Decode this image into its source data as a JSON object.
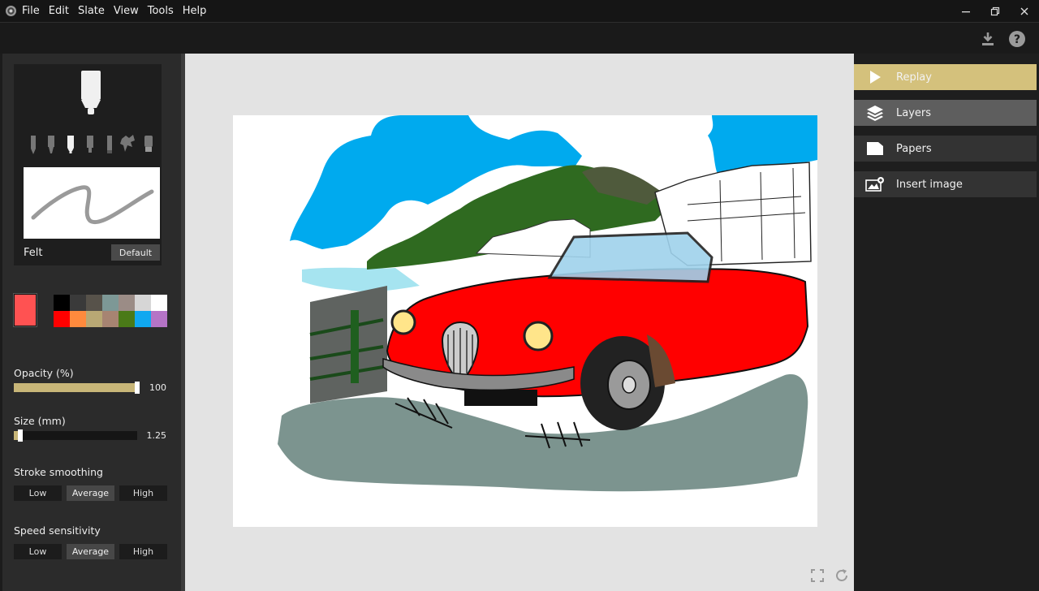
{
  "menu": [
    "File",
    "Edit",
    "Slate",
    "View",
    "Tools",
    "Help"
  ],
  "brush": {
    "name": "Felt",
    "default_label": "Default"
  },
  "colors": {
    "current": "#ff5252",
    "swatches": [
      "#000000",
      "#3a3a3a",
      "#57524a",
      "#7d9896",
      "#9b8c86",
      "#d6d6d6",
      "#ffffff",
      "#ff0000",
      "#ff8a3d",
      "#b8a874",
      "#a78472",
      "#4a7a18",
      "#10a8f0",
      "#b574c6"
    ]
  },
  "opacity": {
    "label": "Opacity (%)",
    "value": "100",
    "fraction": 1.0
  },
  "size": {
    "label": "Size (mm)",
    "value": "1.25",
    "fraction": 0.05
  },
  "stroke_smoothing": {
    "label": "Stroke smoothing",
    "options": [
      "Low",
      "Average",
      "High"
    ],
    "selected": "Average"
  },
  "speed_sensitivity": {
    "label": "Speed sensitivity",
    "options": [
      "Low",
      "Average",
      "High"
    ],
    "selected": "Average"
  },
  "panel": {
    "replay": "Replay",
    "layers": "Layers",
    "papers": "Papers",
    "insert_image": "Insert image"
  },
  "accent": "#d4c17c"
}
